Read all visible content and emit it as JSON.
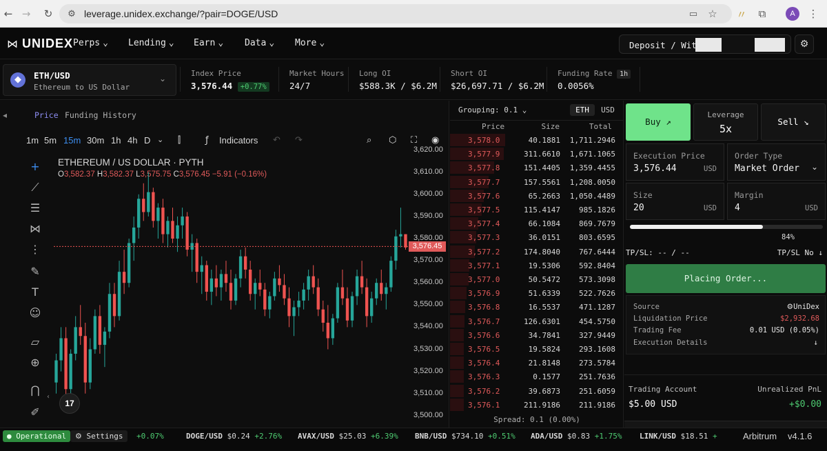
{
  "browser": {
    "url": "leverage.unidex.exchange/?pair=DOGE/USD",
    "profile_initial": "A"
  },
  "nav": {
    "brand": "UNIDEX",
    "items": [
      "Perps",
      "Lending",
      "Earn",
      "Data",
      "More"
    ],
    "deposit_label": "Deposit / Wit"
  },
  "market": {
    "pair": "ETH/USD",
    "pair_desc": "Ethereum to US Dollar",
    "index_price_label": "Index Price",
    "index_price": "3,576.44",
    "index_change": "+0.77%",
    "market_hours_label": "Market Hours",
    "market_hours": "24/7",
    "long_oi_label": "Long OI",
    "long_oi": "$588.3K / $6.2M",
    "short_oi_label": "Short OI",
    "short_oi": "$26,697.71 / $6.2M",
    "funding_label": "Funding Rate",
    "funding_period": "1h",
    "funding_value": "0.0056%"
  },
  "chart": {
    "tabs": [
      "Price",
      "Funding History"
    ],
    "timeframes": [
      "1m",
      "5m",
      "15m",
      "30m",
      "1h",
      "4h",
      "D"
    ],
    "active_timeframe": "15m",
    "indicators_label": "Indicators",
    "title": "ETHEREUM / US DOLLAR · PYTH",
    "ohlc": {
      "o": "3,582.37",
      "h": "3,582.37",
      "l": "3,575.75",
      "c": "3,576.45",
      "chg": "−5.91 (−0.16%)"
    },
    "price_tag": "3,576.45",
    "tv_logo": "17"
  },
  "chart_data": {
    "type": "candlestick",
    "title": "ETHEREUM / US DOLLAR · PYTH",
    "y_ticks": [
      3620,
      3610,
      3600,
      3590,
      3580,
      3570,
      3560,
      3550,
      3540,
      3530,
      3520,
      3510,
      3500
    ],
    "ylim": [
      3499,
      3623
    ],
    "last_price": 3576.45,
    "candles": [
      [
        3515,
        3528,
        3510,
        3525
      ],
      [
        3525,
        3540,
        3520,
        3535
      ],
      [
        3535,
        3540,
        3505,
        3512
      ],
      [
        3512,
        3530,
        3508,
        3528
      ],
      [
        3528,
        3545,
        3525,
        3540
      ],
      [
        3540,
        3550,
        3532,
        3536
      ],
      [
        3536,
        3542,
        3510,
        3515
      ],
      [
        3515,
        3535,
        3512,
        3530
      ],
      [
        3530,
        3548,
        3528,
        3545
      ],
      [
        3545,
        3550,
        3528,
        3532
      ],
      [
        3532,
        3540,
        3522,
        3538
      ],
      [
        3538,
        3560,
        3535,
        3555
      ],
      [
        3555,
        3560,
        3540,
        3545
      ],
      [
        3545,
        3570,
        3543,
        3565
      ],
      [
        3565,
        3575,
        3555,
        3560
      ],
      [
        3560,
        3580,
        3558,
        3578
      ],
      [
        3578,
        3590,
        3570,
        3585
      ],
      [
        3585,
        3600,
        3580,
        3598
      ],
      [
        3598,
        3605,
        3588,
        3592
      ],
      [
        3592,
        3610,
        3590,
        3601
      ],
      [
        3601,
        3603,
        3585,
        3588
      ],
      [
        3588,
        3596,
        3580,
        3594
      ],
      [
        3594,
        3598,
        3578,
        3582
      ],
      [
        3582,
        3590,
        3576,
        3588
      ],
      [
        3588,
        3594,
        3578,
        3580
      ],
      [
        3580,
        3590,
        3574,
        3586
      ],
      [
        3586,
        3594,
        3580,
        3590
      ],
      [
        3590,
        3592,
        3572,
        3575
      ],
      [
        3575,
        3582,
        3565,
        3578
      ],
      [
        3578,
        3580,
        3560,
        3565
      ],
      [
        3565,
        3572,
        3555,
        3568
      ],
      [
        3568,
        3570,
        3552,
        3556
      ],
      [
        3556,
        3566,
        3550,
        3562
      ],
      [
        3562,
        3568,
        3554,
        3558
      ],
      [
        3558,
        3566,
        3552,
        3564
      ],
      [
        3564,
        3570,
        3556,
        3560
      ],
      [
        3560,
        3566,
        3548,
        3552
      ],
      [
        3552,
        3564,
        3550,
        3562
      ],
      [
        3562,
        3575,
        3558,
        3572
      ],
      [
        3572,
        3576,
        3562,
        3566
      ],
      [
        3566,
        3570,
        3552,
        3555
      ],
      [
        3555,
        3562,
        3548,
        3560
      ],
      [
        3560,
        3566,
        3554,
        3557
      ],
      [
        3557,
        3560,
        3545,
        3548
      ],
      [
        3548,
        3556,
        3544,
        3554
      ],
      [
        3554,
        3565,
        3552,
        3562
      ],
      [
        3562,
        3568,
        3556,
        3559
      ],
      [
        3559,
        3564,
        3550,
        3553
      ],
      [
        3553,
        3558,
        3540,
        3545
      ],
      [
        3545,
        3552,
        3536,
        3549
      ],
      [
        3549,
        3556,
        3545,
        3552
      ],
      [
        3552,
        3560,
        3548,
        3557
      ],
      [
        3557,
        3566,
        3552,
        3563
      ],
      [
        3563,
        3568,
        3555,
        3558
      ],
      [
        3558,
        3562,
        3545,
        3548
      ],
      [
        3548,
        3552,
        3538,
        3542
      ],
      [
        3542,
        3550,
        3530,
        3535
      ],
      [
        3535,
        3546,
        3532,
        3544
      ],
      [
        3544,
        3560,
        3542,
        3558
      ],
      [
        3558,
        3566,
        3550,
        3553
      ],
      [
        3553,
        3558,
        3540,
        3543
      ],
      [
        3543,
        3556,
        3540,
        3554
      ],
      [
        3554,
        3566,
        3550,
        3563
      ],
      [
        3563,
        3570,
        3555,
        3558
      ],
      [
        3558,
        3562,
        3540,
        3545
      ],
      [
        3545,
        3556,
        3542,
        3553
      ],
      [
        3553,
        3562,
        3550,
        3560
      ],
      [
        3560,
        3566,
        3552,
        3555
      ],
      [
        3555,
        3560,
        3548,
        3558
      ],
      [
        3558,
        3572,
        3556,
        3570
      ],
      [
        3570,
        3584,
        3566,
        3581
      ],
      [
        3581,
        3594,
        3576,
        3582
      ],
      [
        3582,
        3582,
        3575,
        3576
      ]
    ]
  },
  "orderbook": {
    "grouping_label": "Grouping: 0.1",
    "toggle": [
      "ETH",
      "USD"
    ],
    "headers": [
      "Price",
      "Size",
      "Total"
    ],
    "rows": [
      [
        "3,578.0",
        "40.1881",
        "1,711.2946"
      ],
      [
        "3,577.9",
        "311.6610",
        "1,671.1065"
      ],
      [
        "3,577.8",
        "151.4405",
        "1,359.4455"
      ],
      [
        "3,577.7",
        "157.5561",
        "1,208.0050"
      ],
      [
        "3,577.6",
        "65.2663",
        "1,050.4489"
      ],
      [
        "3,577.5",
        "115.4147",
        "985.1826"
      ],
      [
        "3,577.4",
        "66.1084",
        "869.7679"
      ],
      [
        "3,577.3",
        "36.0151",
        "803.6595"
      ],
      [
        "3,577.2",
        "174.8040",
        "767.6444"
      ],
      [
        "3,577.1",
        "19.5306",
        "592.8404"
      ],
      [
        "3,577.0",
        "50.5472",
        "573.3098"
      ],
      [
        "3,576.9",
        "51.6339",
        "522.7626"
      ],
      [
        "3,576.8",
        "16.5537",
        "471.1287"
      ],
      [
        "3,576.7",
        "126.6301",
        "454.5750"
      ],
      [
        "3,576.6",
        "34.7841",
        "327.9449"
      ],
      [
        "3,576.5",
        "19.5824",
        "293.1608"
      ],
      [
        "3,576.4",
        "21.8148",
        "273.5784"
      ],
      [
        "3,576.3",
        "0.1577",
        "251.7636"
      ],
      [
        "3,576.2",
        "39.6873",
        "251.6059"
      ],
      [
        "3,576.1",
        "211.9186",
        "211.9186"
      ]
    ],
    "spread": "Spread: 0.1 (0.00%)"
  },
  "trade": {
    "buy_label": "Buy ↗",
    "leverage_label": "Leverage",
    "leverage_value": "5x",
    "sell_label": "Sell ↘",
    "exec_label": "Execution Price",
    "exec_value": "3,576.44",
    "exec_unit": "USD",
    "order_type_label": "Order Type",
    "order_type_value": "Market Order",
    "size_label": "Size",
    "size_value": "20",
    "size_unit": "USD",
    "margin_label": "Margin",
    "margin_value": "4",
    "margin_unit": "USD",
    "slider_pct": "84%",
    "slider_fraction": 0.84,
    "tpsl_label": "TP/SL: -- / --",
    "tpsl_toggle": "TP/SL No ↓",
    "placing_label": "Placing Order...",
    "source_label": "Source",
    "source_value": "UniDex",
    "liq_label": "Liquidation Price",
    "liq_value": "$2,932.68",
    "fee_label": "Trading Fee",
    "fee_value": "0.01 USD (0.05%)",
    "exec_details_label": "Execution Details",
    "exec_details_icon": "↓",
    "account_label": "Trading Account",
    "account_value": "$5.00 USD",
    "pnl_label": "Unrealized PnL",
    "pnl_value": "+$0.00"
  },
  "footer": {
    "status": "Operational",
    "settings": "Settings",
    "first_change": "+0.07%",
    "tickers": [
      {
        "pair": "DOGE/USD",
        "price": "$0.24",
        "chg": "+2.76%"
      },
      {
        "pair": "AVAX/USD",
        "price": "$25.03",
        "chg": "+6.39%"
      },
      {
        "pair": "BNB/USD",
        "price": "$734.10",
        "chg": "+0.51%"
      },
      {
        "pair": "ADA/USD",
        "price": "$0.83",
        "chg": "+1.75%"
      },
      {
        "pair": "LINK/USD",
        "price": "$18.51",
        "chg": "+"
      }
    ],
    "network": "Arbitrum",
    "version": "v4.1.6"
  },
  "colors": {
    "accent_green": "#4ecb71",
    "buy_bg": "#6fe38a",
    "red": "#e05a5a",
    "placing_bg": "#2f7d45"
  }
}
